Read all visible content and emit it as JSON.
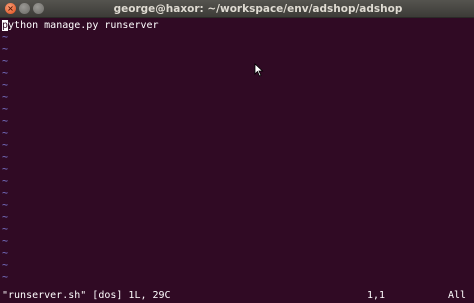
{
  "window": {
    "title": "george@haxor: ~/workspace/env/adshop/adshop",
    "close_glyph": "×",
    "minimize_glyph": "",
    "maximize_glyph": ""
  },
  "editor": {
    "first_char": "p",
    "rest_of_line": "ython manage.py runserver",
    "tilde": "~",
    "empty_line_count": 21
  },
  "status": {
    "file_info": "\"runserver.sh\" [dos] 1L, 29C",
    "cursor_position": "1,1",
    "scroll": "All"
  },
  "colors": {
    "background": "#300a24",
    "text": "#ffffff",
    "tilde": "#7f7fdb",
    "titlebar": "#3c3b37",
    "close_button": "#df4a16"
  }
}
